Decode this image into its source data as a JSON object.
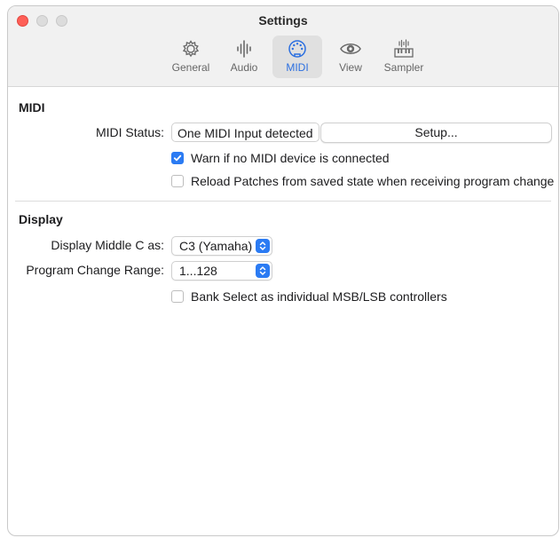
{
  "window": {
    "title": "Settings"
  },
  "toolbar": {
    "tabs": [
      {
        "label": "General",
        "icon": "gear-icon"
      },
      {
        "label": "Audio",
        "icon": "waveform-icon"
      },
      {
        "label": "MIDI",
        "icon": "midi-port-icon",
        "active": true
      },
      {
        "label": "View",
        "icon": "eye-icon"
      },
      {
        "label": "Sampler",
        "icon": "keyboard-waveform-icon"
      }
    ]
  },
  "midi": {
    "heading": "MIDI",
    "status_label": "MIDI Status:",
    "status_value": "One MIDI Input detected",
    "setup_label": "Setup...",
    "warn_label": "Warn if no MIDI device is connected",
    "warn_checked": true,
    "reload_label": "Reload Patches from saved state when receiving program change",
    "reload_checked": false
  },
  "display": {
    "heading": "Display",
    "middle_c_label": "Display Middle C as:",
    "middle_c_value": "C3 (Yamaha)",
    "program_range_label": "Program Change Range:",
    "program_range_value": "1...128",
    "bank_select_label": "Bank Select as individual MSB/LSB controllers",
    "bank_select_checked": false
  },
  "colors": {
    "accent": "#2b7bf3",
    "close": "#fe5f57"
  }
}
